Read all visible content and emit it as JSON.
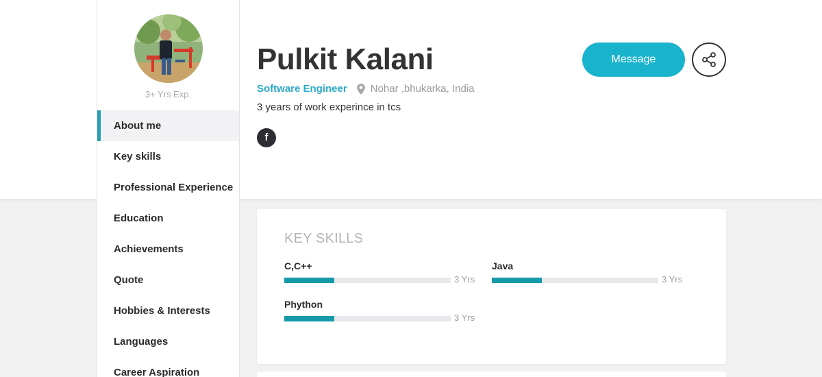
{
  "profile": {
    "name": "Pulkit Kalani",
    "title": "Software Engineer",
    "location": "Nohar ,bhukarka, India",
    "about": "3 years of work experince in tcs",
    "experience": "3+ Yrs Exp.",
    "facebook_label": "f"
  },
  "actions": {
    "message_label": "Message"
  },
  "nav": {
    "items": [
      {
        "label": "About me",
        "active": true
      },
      {
        "label": "Key skills",
        "active": false
      },
      {
        "label": "Professional Experience",
        "active": false
      },
      {
        "label": "Education",
        "active": false
      },
      {
        "label": "Achievements",
        "active": false
      },
      {
        "label": "Quote",
        "active": false
      },
      {
        "label": "Hobbies & Interests",
        "active": false
      },
      {
        "label": "Languages",
        "active": false
      },
      {
        "label": "Career Aspiration",
        "active": false
      }
    ]
  },
  "skills": {
    "title": "KEY SKILLS",
    "items": [
      {
        "name": "C,C++",
        "years": "3 Yrs",
        "level": 0.3
      },
      {
        "name": "Java",
        "years": "3 Yrs",
        "level": 0.3
      },
      {
        "name": "Phython",
        "years": "3 Yrs",
        "level": 0.3
      }
    ]
  },
  "colors": {
    "accent": "#1ab3cd",
    "skill_fill": "#169aa9",
    "title_blue": "#2ba9c7"
  }
}
